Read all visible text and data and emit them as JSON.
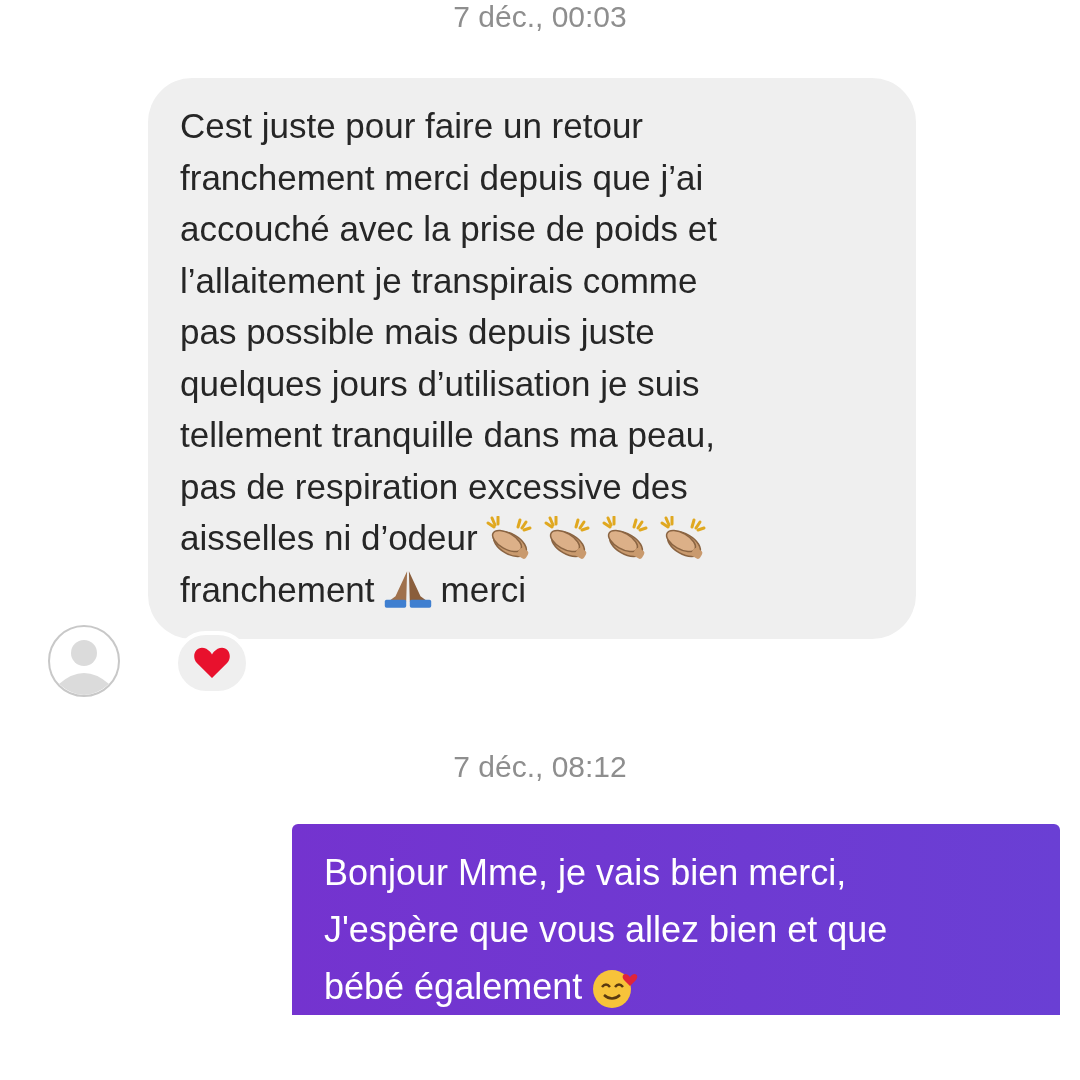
{
  "thread": [
    {
      "kind": "timestamp",
      "text": "7 déc., 00:03"
    },
    {
      "kind": "received",
      "heart_reaction": true,
      "lines": [
        [
          {
            "kind": "text",
            "text": "Cest juste pour faire un retour"
          }
        ],
        [
          {
            "kind": "text",
            "text": "franchement merci depuis que j’ai"
          }
        ],
        [
          {
            "kind": "text",
            "text": "accouché avec la prise de poids et"
          }
        ],
        [
          {
            "kind": "text",
            "text": "l’allaitement je transpirais comme"
          }
        ],
        [
          {
            "kind": "text",
            "text": "pas possible mais depuis juste"
          }
        ],
        [
          {
            "kind": "text",
            "text": "quelques jours d’utilisation je suis"
          }
        ],
        [
          {
            "kind": "text",
            "text": "tellement tranquille dans ma peau,"
          }
        ],
        [
          {
            "kind": "text",
            "text": "pas de respiration excessive des"
          }
        ],
        [
          {
            "kind": "text",
            "text": "aisselles ni d’odeur"
          },
          {
            "kind": "clap"
          },
          {
            "kind": "clap"
          },
          {
            "kind": "clap"
          },
          {
            "kind": "clap"
          }
        ],
        [
          {
            "kind": "text",
            "text": "franchement"
          },
          {
            "kind": "pray"
          },
          {
            "kind": "text",
            "text": "merci"
          }
        ]
      ]
    },
    {
      "kind": "timestamp",
      "text": "7 déc., 08:12"
    },
    {
      "kind": "sent",
      "lines": [
        [
          {
            "kind": "text",
            "text": "Bonjour Mme, je vais bien merci,"
          }
        ],
        [
          {
            "kind": "text",
            "text": "J'espère que vous allez bien et que"
          }
        ],
        [
          {
            "kind": "text",
            "text": "bébé également"
          },
          {
            "kind": "smile"
          }
        ]
      ]
    }
  ]
}
